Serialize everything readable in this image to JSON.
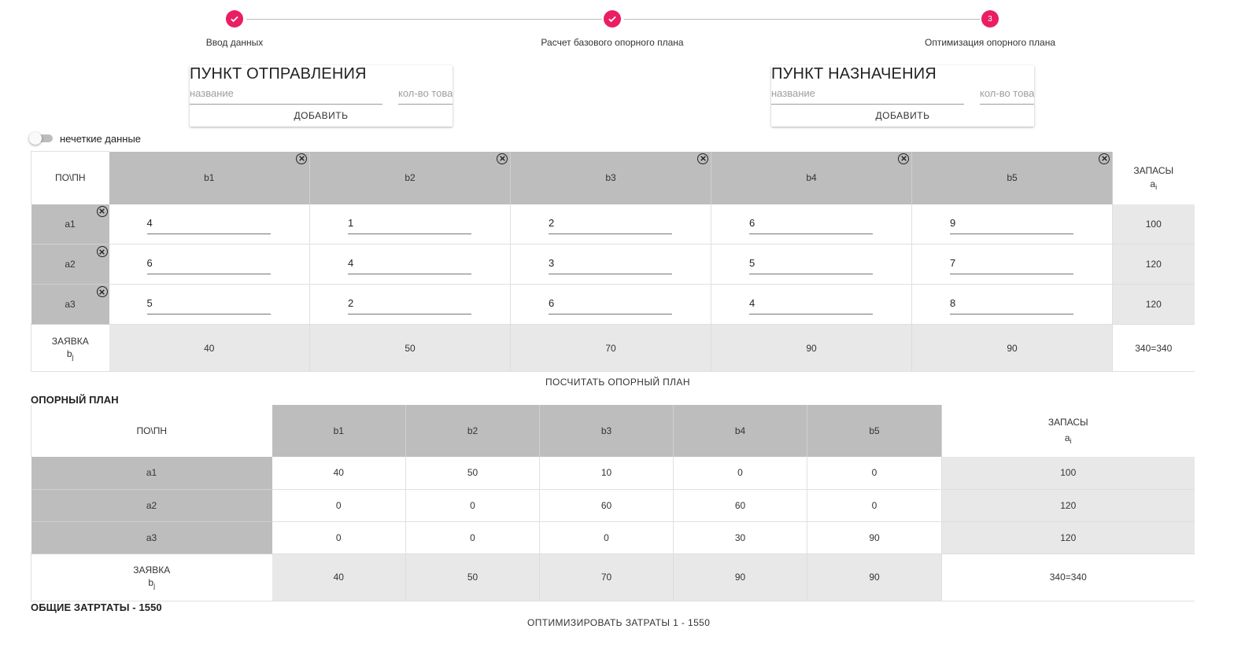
{
  "stepper": {
    "steps": [
      {
        "label": "Ввод данных",
        "state": "done",
        "icon": "check-icon"
      },
      {
        "label": "Расчет базового опорного плана",
        "state": "done",
        "icon": "check-icon"
      },
      {
        "label": "Оптимизация опорного плана",
        "state": "active",
        "number": "3"
      }
    ],
    "accent_color": "#e91e63"
  },
  "origin_card": {
    "title": "ПУНКТ ОТПРАВЛЕНИЯ",
    "name_placeholder": "название",
    "qty_placeholder": "кол-во товара",
    "add_label": "ДОБАВИТЬ"
  },
  "dest_card": {
    "title": "ПУНКТ НАЗНАЧЕНИЯ",
    "name_placeholder": "название",
    "qty_placeholder": "кол-во товара",
    "add_label": "ДОБАВИТЬ"
  },
  "fuzzy_toggle": {
    "label": "нечеткие данные",
    "checked": false
  },
  "cost_table": {
    "corner": "ПО\\ПН",
    "columns": [
      "b1",
      "b2",
      "b3",
      "b4",
      "b5"
    ],
    "supply_header": "ЗАПАСЫ",
    "supply_sub": "a",
    "supply_sub_index": "i",
    "rows": [
      {
        "name": "a1",
        "costs": [
          "4",
          "1",
          "2",
          "6",
          "9"
        ],
        "supply": "100"
      },
      {
        "name": "a2",
        "costs": [
          "6",
          "4",
          "3",
          "5",
          "7"
        ],
        "supply": "120"
      },
      {
        "name": "a3",
        "costs": [
          "5",
          "2",
          "6",
          "4",
          "8"
        ],
        "supply": "120"
      }
    ],
    "demand_label": "ЗАЯВКА",
    "demand_sub": "b",
    "demand_sub_index": "j",
    "demand": [
      "40",
      "50",
      "70",
      "90",
      "90"
    ],
    "balance": "340=340"
  },
  "compute_button": "ПОСЧИТАТЬ ОПОРНЫЙ ПЛАН",
  "plan_section": {
    "title": "ОПОРНЫЙ ПЛАН",
    "corner": "ПО\\ПН",
    "columns": [
      "b1",
      "b2",
      "b3",
      "b4",
      "b5"
    ],
    "supply_header": "ЗАПАСЫ",
    "supply_sub": "a",
    "supply_sub_index": "i",
    "rows": [
      {
        "name": "a1",
        "values": [
          "40",
          "50",
          "10",
          "0",
          "0"
        ],
        "supply": "100"
      },
      {
        "name": "a2",
        "values": [
          "0",
          "0",
          "60",
          "60",
          "0"
        ],
        "supply": "120"
      },
      {
        "name": "a3",
        "values": [
          "0",
          "0",
          "0",
          "30",
          "90"
        ],
        "supply": "120"
      }
    ],
    "demand_label": "ЗАЯВКА",
    "demand_sub": "b",
    "demand_sub_index": "j",
    "demand": [
      "40",
      "50",
      "70",
      "90",
      "90"
    ],
    "balance": "340=340"
  },
  "total_cost": "ОБЩИЕ ЗАТРТАТЫ - 1550",
  "optimize_button": "ОПТИМИЗИРОВАТЬ ЗАТРАТЫ 1 - 1550"
}
